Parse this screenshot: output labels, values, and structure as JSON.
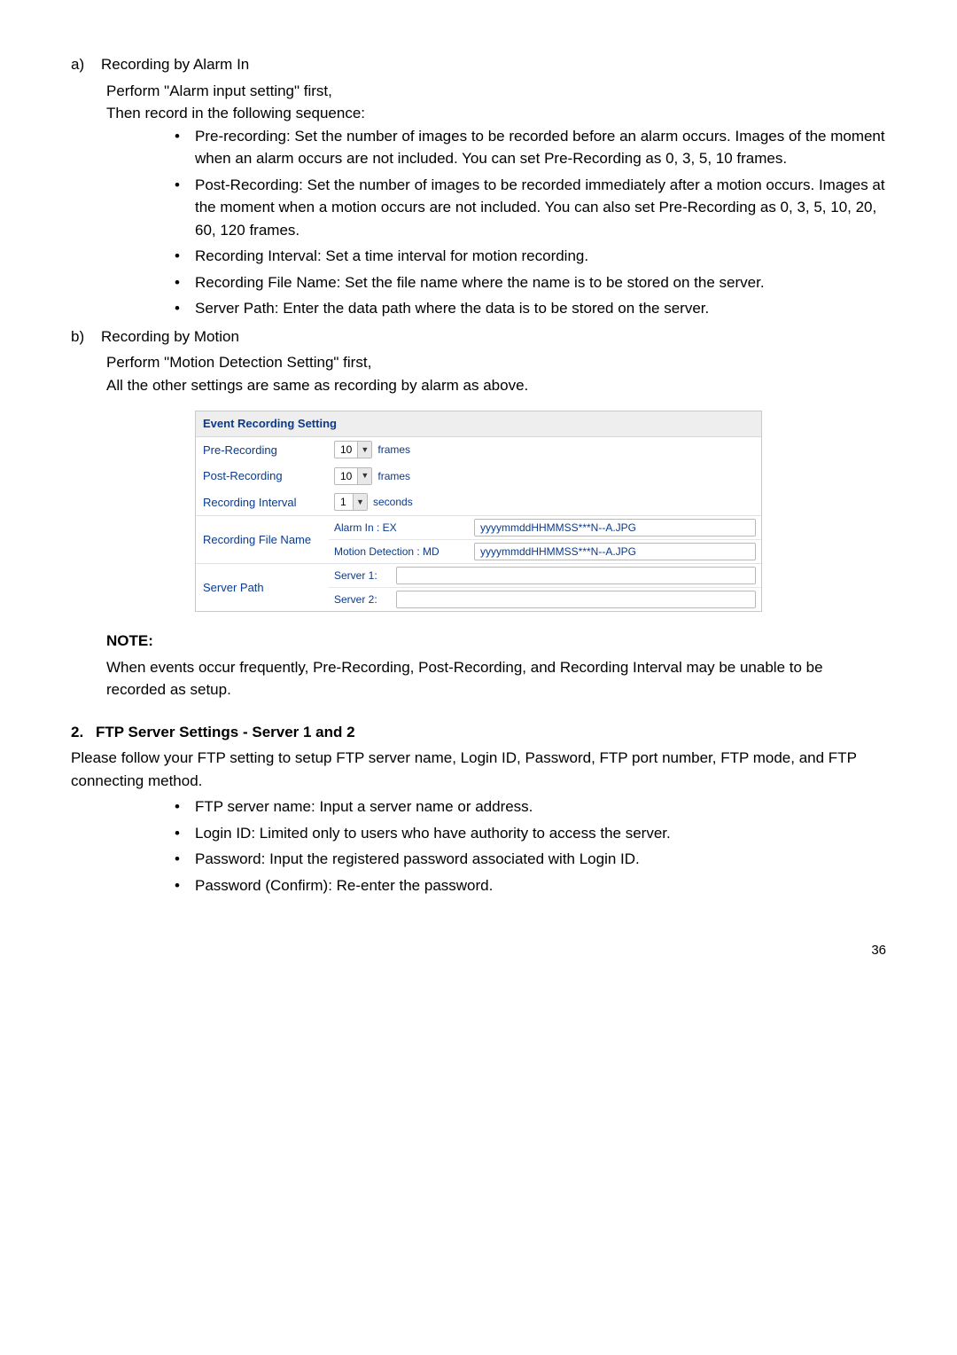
{
  "a": {
    "marker": "a)",
    "title": "Recording by Alarm In",
    "line1": "Perform \"Alarm input setting\" first,",
    "line2": "Then record in the following sequence:",
    "bullets": [
      "Pre-recording: Set the number of images to be recorded before an alarm occurs. Images of the moment when an alarm occurs are not included. You can set Pre-Recording as 0, 3, 5, 10 frames.",
      "Post-Recording: Set the number of images to be recorded immediately after a motion occurs. Images at the moment when a motion occurs are not included. You can also set Pre-Recording as 0, 3, 5, 10, 20, 60, 120 frames.",
      "Recording Interval: Set a time interval for motion recording.",
      "Recording File Name: Set the file name where the name is to be stored on the server.",
      "Server Path: Enter the data path where the data is to be stored on the server."
    ]
  },
  "b": {
    "marker": "b)",
    "title": "Recording by Motion",
    "line1": "Perform \"Motion Detection Setting\" first,",
    "line2": "All the other settings are same as recording by alarm as above."
  },
  "settings": {
    "header": "Event Recording Setting",
    "pre_label": "Pre-Recording",
    "pre_val": "10",
    "post_label": "Post-Recording",
    "post_val": "10",
    "frames": "frames",
    "interval_label": "Recording Interval",
    "interval_val": "1",
    "seconds": "seconds",
    "filename_label": "Recording File Name",
    "alarm_label": "Alarm In : EX",
    "md_label": "Motion Detection : MD",
    "filename_val": "yyyymmddHHMMSS***N--A.JPG",
    "server_label": "Server Path",
    "server1": "Server 1:",
    "server2": "Server 2:"
  },
  "note": {
    "heading": "NOTE:",
    "body": "When events occur frequently, Pre-Recording, Post-Recording, and Recording Interval may be unable to be recorded as setup."
  },
  "ftp": {
    "num": "2.",
    "title": "FTP Server Settings - Server 1 and 2",
    "intro": "Please follow your FTP setting to setup FTP server name, Login ID, Password, FTP port number, FTP mode, and FTP connecting method.",
    "bullets": [
      "FTP server name: Input a server name or address.",
      "Login ID: Limited only to users who have authority to access the server.",
      "Password: Input the registered password associated with Login ID.",
      "Password (Confirm): Re-enter the password."
    ]
  },
  "page": "36"
}
